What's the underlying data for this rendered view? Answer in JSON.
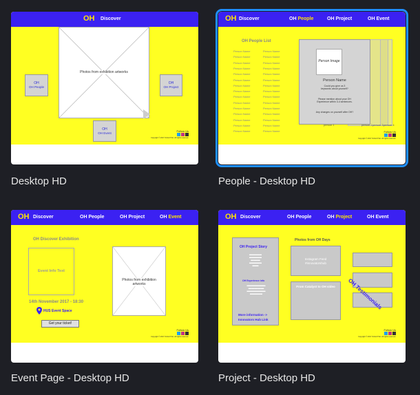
{
  "cards": [
    {
      "caption": "Desktop HD",
      "selected": false
    },
    {
      "caption": "People - Desktop HD",
      "selected": true
    },
    {
      "caption": "Event Page - Desktop HD",
      "selected": false
    },
    {
      "caption": "Project - Desktop HD",
      "selected": false
    }
  ],
  "c1": {
    "logo": "OH",
    "discover": "Discover",
    "photos": "Photos from exhibition artworks",
    "people": "OH People",
    "project": "OH Project",
    "event": "OH Event",
    "follow": "Follow Us",
    "copyright": "Copyright © 2017 Oxford Hub. All rights reserved."
  },
  "c2": {
    "logo": "OH",
    "discover": "Discover",
    "people": "OH People",
    "project": "OH Project",
    "event": "OH Event",
    "list_title": "OH People List",
    "person_name": "Person Name",
    "person_image": "Person Image",
    "profile_name": "Person Name",
    "q1": "Could you give us 3 keywords about yourself?",
    "q2": "Please mention about your OH Experience within 3-4 sentences.",
    "q3": "Any changes on yourself after OH?",
    "tab1": "person 1",
    "tab2": "person 2",
    "tab3": "person 3",
    "tab4": "person 4",
    "follow": "Follow Us",
    "copyright": "Copyright © 2017 Oxford Hub. All rights reserved."
  },
  "c3": {
    "logo": "OH",
    "discover": "Discover",
    "people": "OH People",
    "project": "OH Project",
    "event_prefix": "OH",
    "event": "Event",
    "exhibition": "OH Discover Exhibition",
    "info": "Event Info Text",
    "photos": "Photos from exhibition artworks",
    "date": "14th November 2017 - 18:30",
    "venue": "HUS Event Space",
    "ticket": "Get your ticket!",
    "follow": "Follow Us",
    "copyright": "Copyright © 2017 Oxford Hub. All rights reserved."
  },
  "c4": {
    "logo": "OH",
    "discover": "Discover",
    "people": "OH People",
    "project_prefix": "OH",
    "project": "Project",
    "event": "OH Event",
    "story": "OH Project Story",
    "exp": "OH Experience info",
    "more": "More information ->",
    "hub": "Innovators Hub Link",
    "photos_days": "Photos from OH Days",
    "instagram": "Instagram Feed",
    "handle": "#innovatorshub",
    "catalyst": "From Catalyst to OH video",
    "testimonials": "OH Testimonials",
    "follow": "Follow Us",
    "copyright": "Copyright © 2017 Oxford Hub. All rights reserved."
  },
  "colors": {
    "nav": "#3b21f2",
    "yellow": "#ffff22",
    "accent": "#ffe400",
    "selected": "#1e8fff"
  }
}
